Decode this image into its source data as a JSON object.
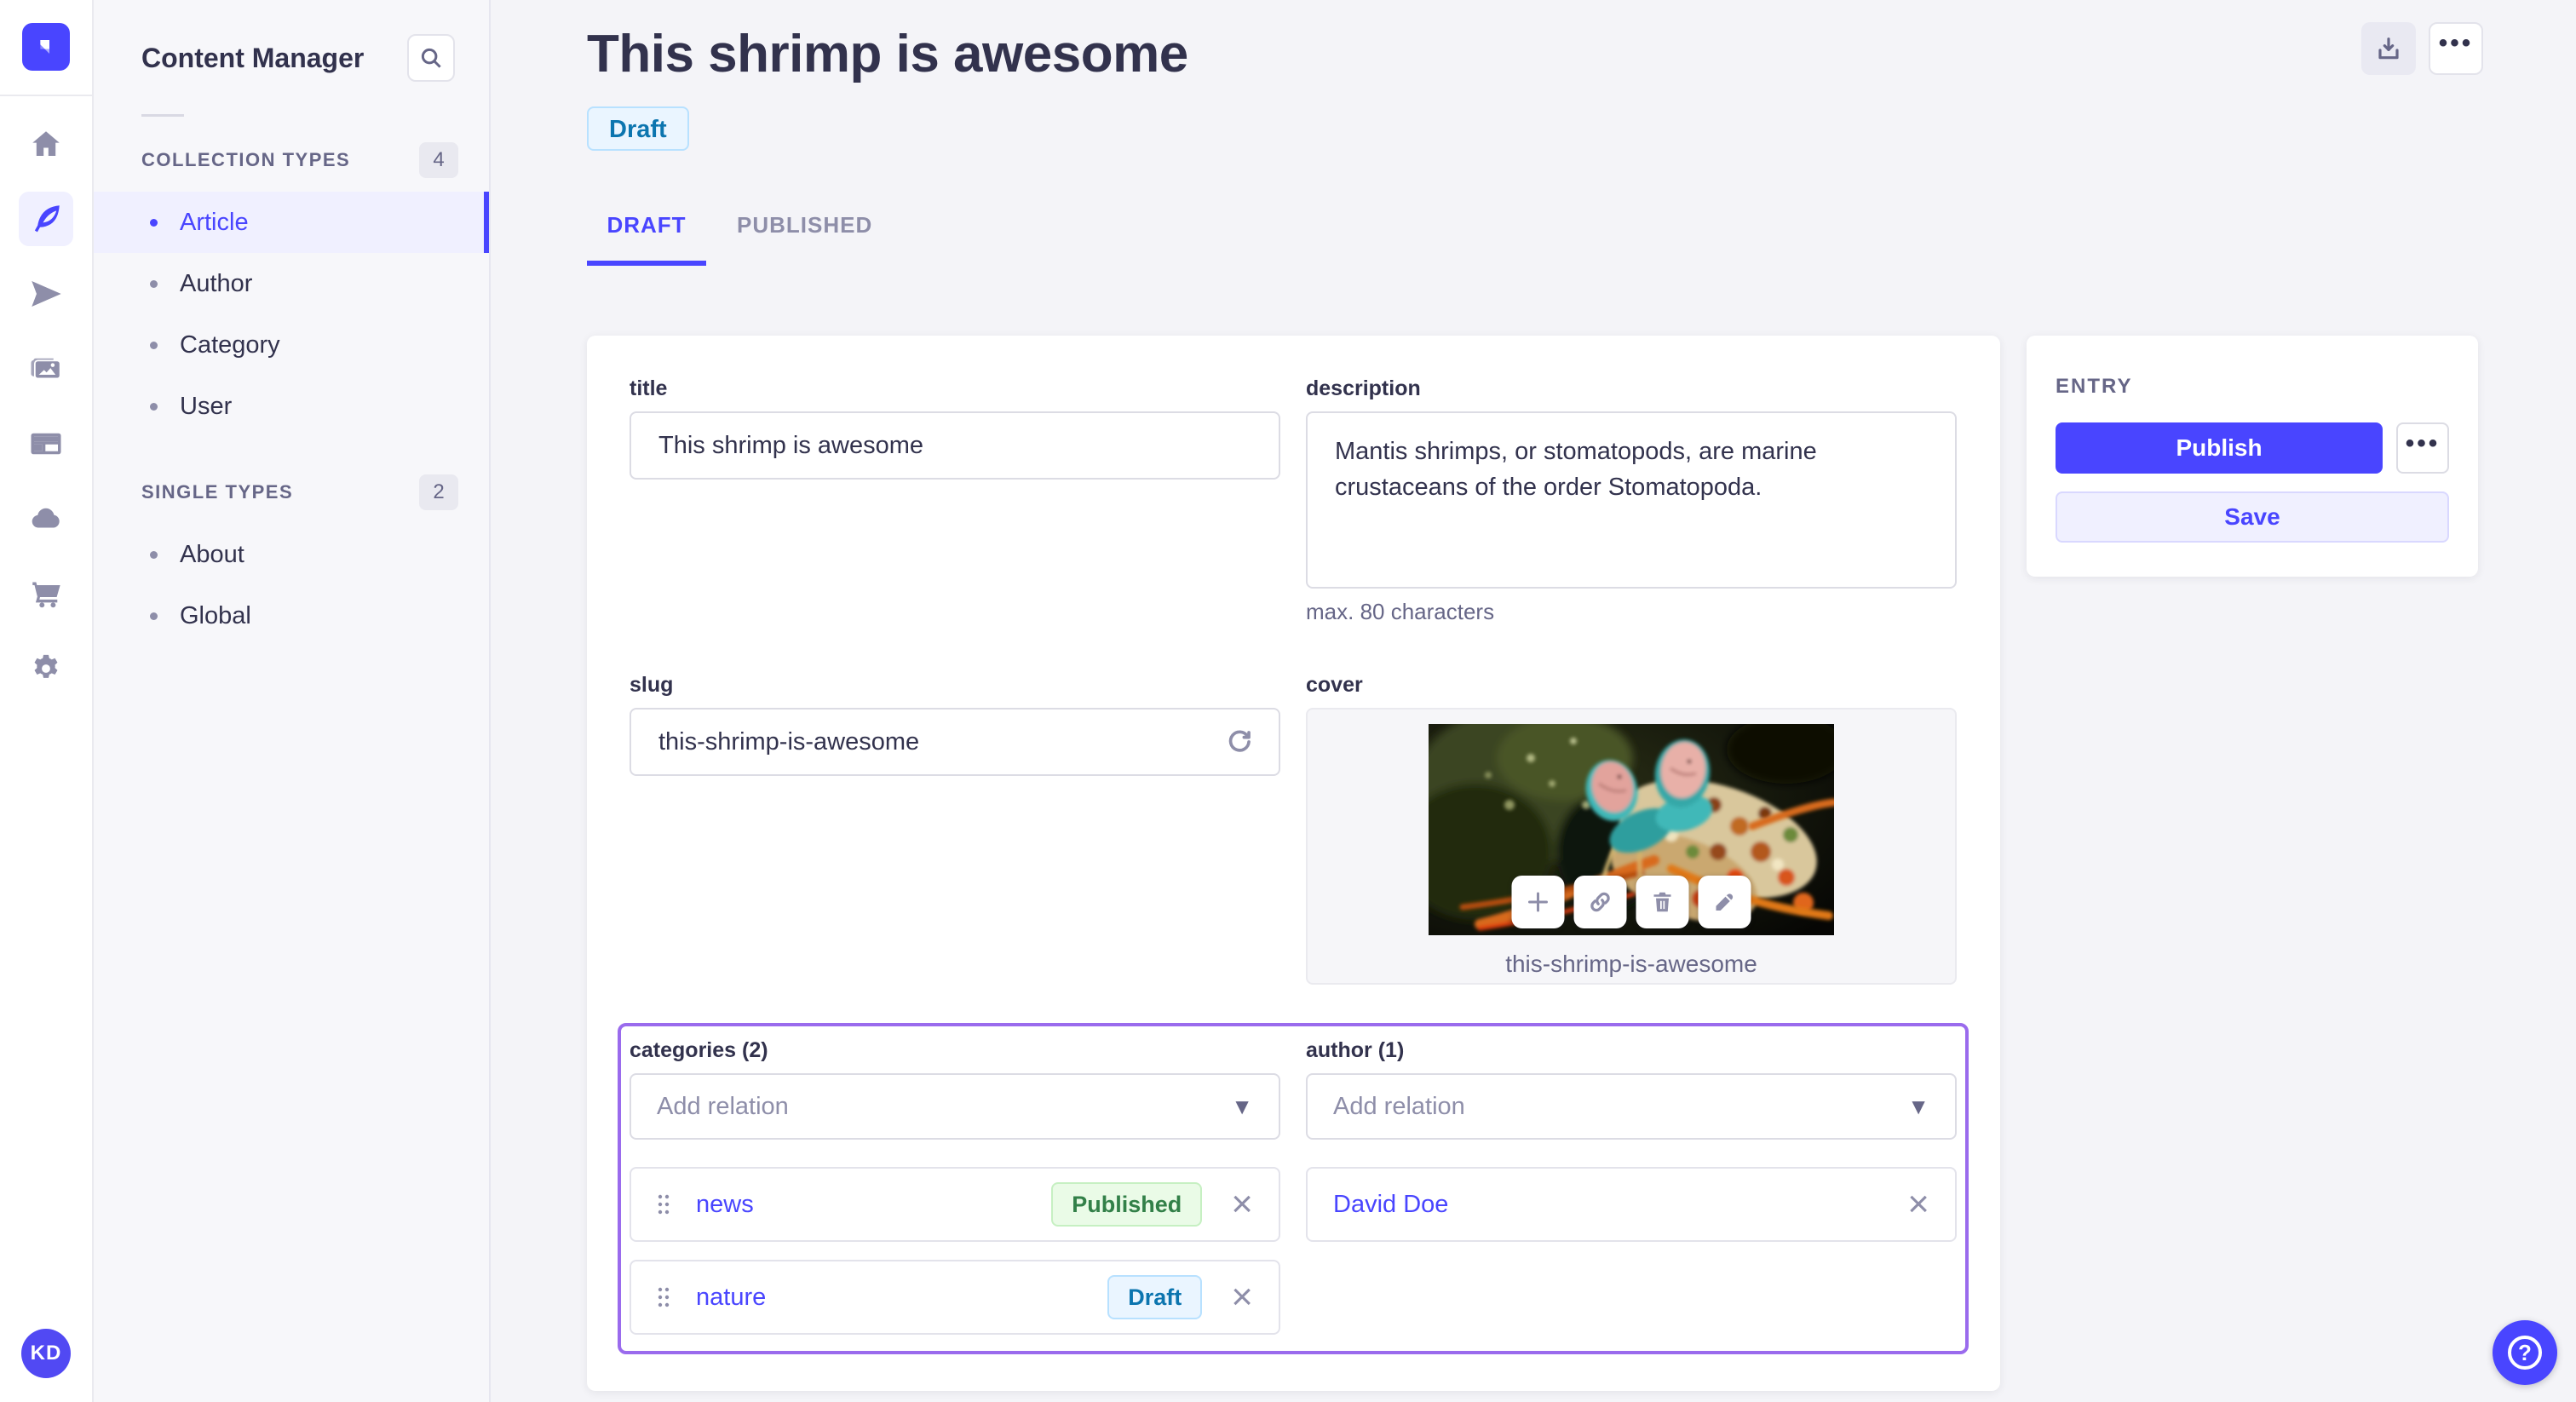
{
  "colors": {
    "primary": "#4945ff",
    "primary_light": "#f0f0ff",
    "relations_outline": "#9a6bed",
    "draft_bg": "#eaf5ff",
    "draft_text": "#0c75af",
    "published_bg": "#eafbe7",
    "published_text": "#328048"
  },
  "nav_rail": {
    "icons": [
      "home-icon",
      "feather-icon",
      "paper-plane-icon",
      "media-library-icon",
      "layout-icon",
      "cloud-icon",
      "cart-icon",
      "gear-icon"
    ],
    "active_icon": "feather-icon",
    "avatar_initials": "KD"
  },
  "subnav": {
    "title": "Content Manager",
    "search_icon": "search-icon",
    "collection_types": {
      "label": "COLLECTION TYPES",
      "count": "4",
      "items": [
        {
          "label": "Article",
          "active": true
        },
        {
          "label": "Author"
        },
        {
          "label": "Category"
        },
        {
          "label": "User"
        }
      ]
    },
    "single_types": {
      "label": "SINGLE TYPES",
      "count": "2",
      "items": [
        {
          "label": "About"
        },
        {
          "label": "Global"
        }
      ]
    }
  },
  "header": {
    "title": "This shrimp is awesome",
    "status": "Draft",
    "actions": [
      "download-icon",
      "more-icon"
    ],
    "tabs": [
      {
        "label": "DRAFT",
        "active": true
      },
      {
        "label": "PUBLISHED",
        "active": false
      }
    ]
  },
  "form": {
    "title": {
      "label": "title",
      "value": "This shrimp is awesome"
    },
    "description": {
      "label": "description",
      "value": "Mantis shrimps, or stomatopods, are marine crustaceans of the order Stomatopoda.",
      "hint": "max. 80 characters"
    },
    "slug": {
      "label": "slug",
      "value": "this-shrimp-is-awesome",
      "action_icon": "refresh-icon"
    },
    "cover": {
      "label": "cover",
      "caption": "this-shrimp-is-awesome",
      "media_actions": [
        "plus-icon",
        "link-icon",
        "trash-icon",
        "pencil-icon"
      ]
    },
    "categories": {
      "label": "categories (2)",
      "placeholder": "Add relation",
      "items": [
        {
          "name": "news",
          "status": "Published"
        },
        {
          "name": "nature",
          "status": "Draft"
        }
      ]
    },
    "author": {
      "label": "author (1)",
      "placeholder": "Add relation",
      "items": [
        {
          "name": "David Doe"
        }
      ]
    }
  },
  "entry": {
    "label": "ENTRY",
    "publish": "Publish",
    "save": "Save"
  },
  "help": {
    "icon": "question-mark-icon"
  }
}
